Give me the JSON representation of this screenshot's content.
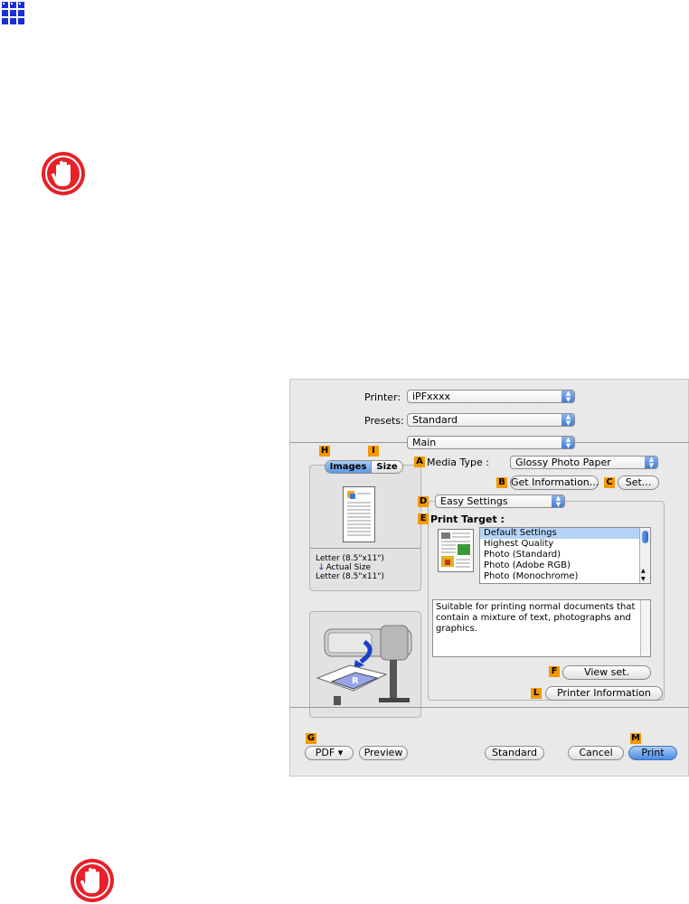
{
  "dialog": {
    "printer_label": "Printer:",
    "printer_value": "iPFxxxx",
    "presets_label": "Presets:",
    "presets_value": "Standard",
    "panel_value": "Main",
    "preview_tabs": {
      "images": "Images",
      "size": "Size"
    },
    "paper_info": {
      "line1": "Letter (8.5\"x11\")",
      "line2": "Actual Size",
      "line3": "Letter (8.5\"x11\")"
    },
    "media_type_label": "Media Type :",
    "media_type_value": "Glossy Photo Paper",
    "get_info_button": "Get Information...",
    "set_button": "Set...",
    "mode_value": "Easy Settings",
    "print_target_label": "Print Target :",
    "print_targets": [
      "Default Settings",
      "Highest Quality",
      "Photo (Standard)",
      "Photo (Adobe RGB)",
      "Photo (Monochrome)"
    ],
    "description": "Suitable for printing normal documents that contain a mixture of text, photographs and graphics.",
    "view_set_button": "View set.",
    "printer_information_button": "Printer Information",
    "pdf_button": "PDF ▾",
    "preview_button": "Preview",
    "standard_button": "Standard",
    "cancel_button": "Cancel",
    "print_button": "Print",
    "badges": {
      "a": "A",
      "b": "B",
      "c": "C",
      "d": "D",
      "e": "E",
      "f": "F",
      "g": "G",
      "h": "H",
      "i": "I",
      "l": "L",
      "m": "M"
    }
  },
  "colors": {
    "accent_blue": "#1a2fd9",
    "stop_red": "#e8202a",
    "badge_orange": "#f39800"
  }
}
